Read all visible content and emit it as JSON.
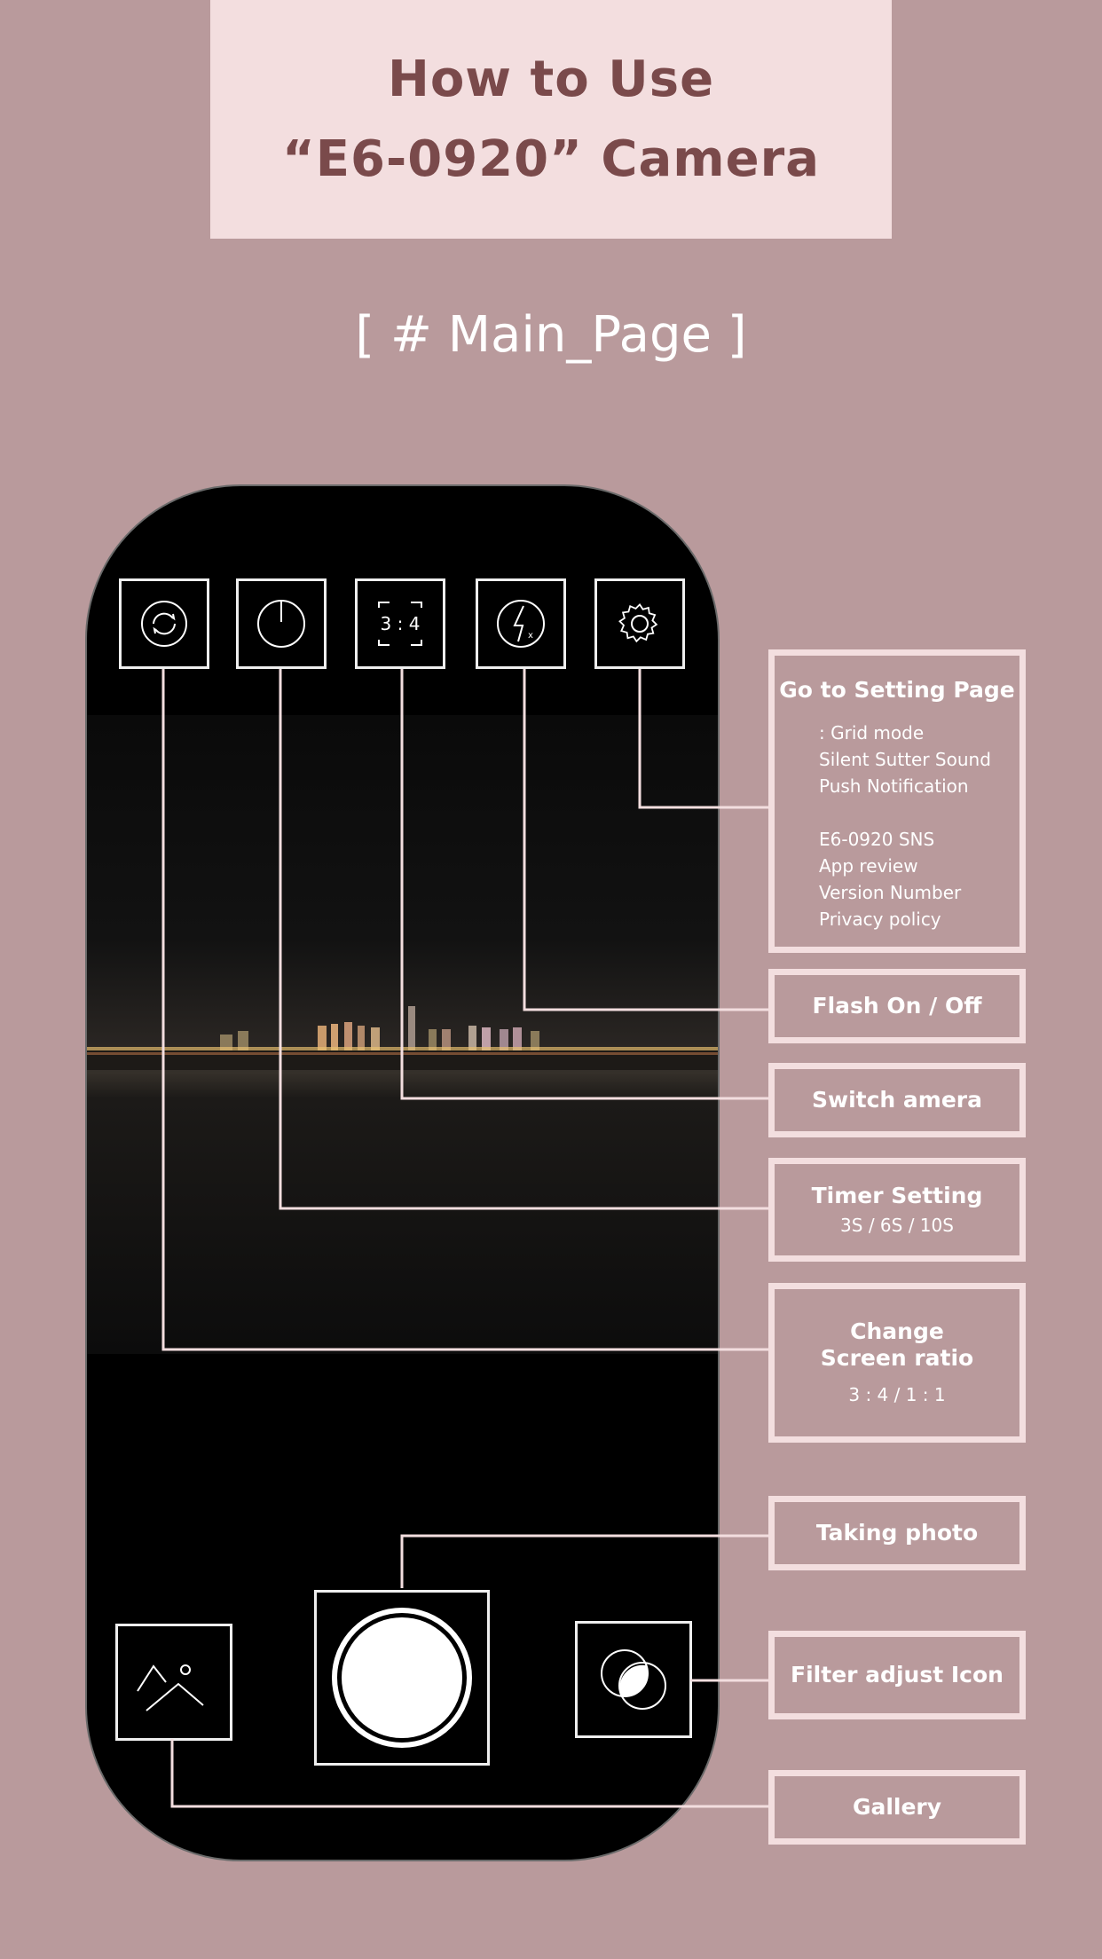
{
  "header": {
    "title_line1": "How to Use",
    "title_line2": "“E6-0920” Camera"
  },
  "page_label": "[ # Main_Page ]",
  "top_icons": [
    {
      "icon": "rotate-camera-icon"
    },
    {
      "icon": "timer-icon"
    },
    {
      "icon": "aspect-ratio-icon",
      "label": "3 : 4"
    },
    {
      "icon": "flash-off-icon"
    },
    {
      "icon": "gear-icon"
    }
  ],
  "bottom_icons": {
    "gallery": "gallery-icon",
    "shutter": "shutter-button",
    "filter": "filter-icon"
  },
  "callouts": {
    "settings": {
      "title": "Go to Setting Page",
      "items_a": [
        ": Grid mode",
        "Silent Sutter Sound",
        "Push Notification"
      ],
      "items_b": [
        "E6-0920 SNS",
        "App review",
        "Version Number",
        "Privacy policy"
      ]
    },
    "flash": {
      "title": "Flash On / Off"
    },
    "switch": {
      "title": "Switch amera"
    },
    "timer": {
      "title": "Timer Setting",
      "sub": "3S / 6S / 10S"
    },
    "ratio": {
      "title_line1": "Change",
      "title_line2": "Screen ratio",
      "sub": "3 : 4 / 1 : 1"
    },
    "photo": {
      "title": "Taking photo"
    },
    "filter": {
      "title": "Filter adjust Icon"
    },
    "gallery": {
      "title": "Gallery"
    }
  },
  "colors": {
    "background": "#b99a9c",
    "title_box": "#f3dedf",
    "title_text": "#7a4a4b",
    "callout_border": "#f3dedf"
  }
}
